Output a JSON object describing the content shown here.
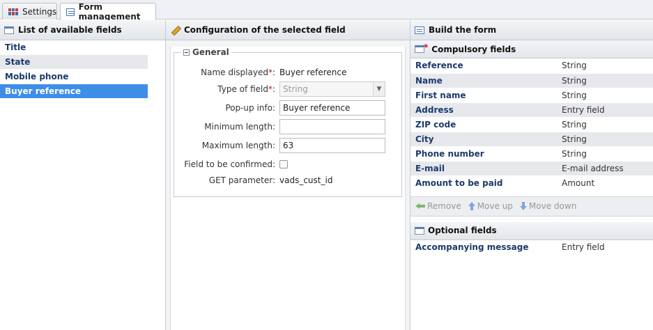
{
  "tabs": [
    {
      "label": "Settings"
    },
    {
      "label": "Form management"
    }
  ],
  "left_panel": {
    "title": "List of available fields",
    "items": [
      "Title",
      "State",
      "Mobile phone",
      "Buyer reference"
    ]
  },
  "mid_panel": {
    "title": "Configuration of the selected field",
    "legend": "General",
    "name_displayed_label": "Name displayed",
    "name_displayed_value": "Buyer reference",
    "type_label": "Type of field",
    "type_value": "String",
    "popup_label": "Pop-up info:",
    "popup_value": "Buyer reference",
    "min_label": "Minimum length:",
    "min_value": "",
    "max_label": "Maximum length:",
    "max_value": "63",
    "confirm_label": "Field to be confirmed:",
    "get_label": "GET parameter:",
    "get_value": "vads_cust_id",
    "required_mark": "*",
    "colon": ":"
  },
  "right_panel": {
    "title": "Build the form",
    "compulsory_title": "Compulsory fields",
    "compulsory_mark": "*",
    "compulsory_rows": [
      {
        "name": "Reference",
        "type": "String"
      },
      {
        "name": "Name",
        "type": "String"
      },
      {
        "name": "First name",
        "type": "String"
      },
      {
        "name": "Address",
        "type": "Entry field"
      },
      {
        "name": "ZIP code",
        "type": "String"
      },
      {
        "name": "City",
        "type": "String"
      },
      {
        "name": "Phone number",
        "type": "String"
      },
      {
        "name": "E-mail",
        "type": "E-mail address"
      },
      {
        "name": "Amount to be paid",
        "type": "Amount"
      }
    ],
    "toolbar": {
      "remove": "Remove",
      "move_up": "Move up",
      "move_down": "Move down"
    },
    "optional_title": "Optional fields",
    "optional_rows": [
      {
        "name": "Accompanying message",
        "type": "Entry field"
      }
    ]
  },
  "colors": {
    "selected": "#3e8ee8",
    "required": "#c4141b",
    "row_alt": "#e6e8ec"
  },
  "icons": [
    "settings-grid-icon",
    "form-icon",
    "window-icon",
    "pencil-icon",
    "collapse-icon",
    "dropdown-arrow-icon",
    "remove-arrow-icon",
    "move-up-icon",
    "move-down-icon"
  ]
}
